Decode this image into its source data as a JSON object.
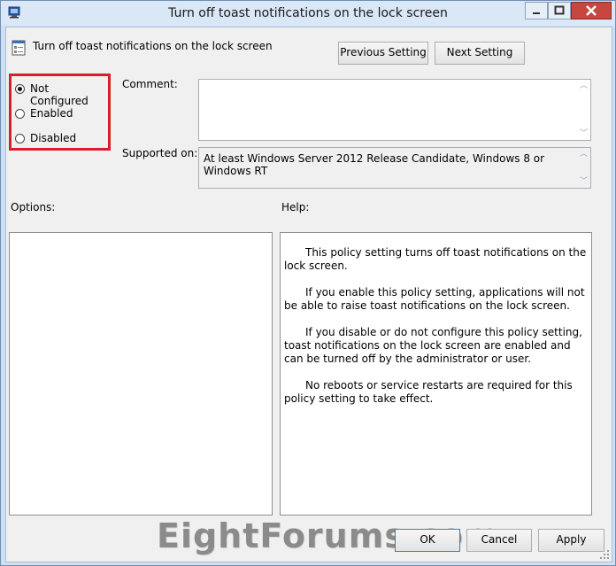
{
  "window": {
    "title": "Turn off toast notifications on the lock screen"
  },
  "header": {
    "setting_name": "Turn off toast notifications on the lock screen"
  },
  "nav": {
    "previous_label": "Previous Setting",
    "next_label": "Next Setting"
  },
  "state": {
    "options": [
      {
        "label": "Not Configured",
        "checked": true
      },
      {
        "label": "Enabled",
        "checked": false
      },
      {
        "label": "Disabled",
        "checked": false
      }
    ]
  },
  "comment": {
    "label": "Comment:",
    "value": ""
  },
  "supported": {
    "label": "Supported on:",
    "value": "At least Windows Server 2012 Release Candidate, Windows 8 or Windows RT"
  },
  "options_panel": {
    "label": "Options:"
  },
  "help_panel": {
    "label": "Help:",
    "paragraphs": [
      "This policy setting turns off toast notifications on the lock screen.",
      "If you enable this policy setting, applications will not be able to raise toast notifications on the lock screen.",
      "If you disable or do not configure this policy setting, toast notifications on the lock screen are enabled and can be turned off by the administrator or user.",
      "No reboots or service restarts are required for this policy setting to take effect."
    ]
  },
  "footer": {
    "ok_label": "OK",
    "cancel_label": "Cancel",
    "apply_label": "Apply"
  },
  "watermark": "EightForums.com",
  "colors": {
    "highlight_box": "#d4202a",
    "title_bar": "#d9e7f6",
    "close_button": "#c7463d"
  }
}
